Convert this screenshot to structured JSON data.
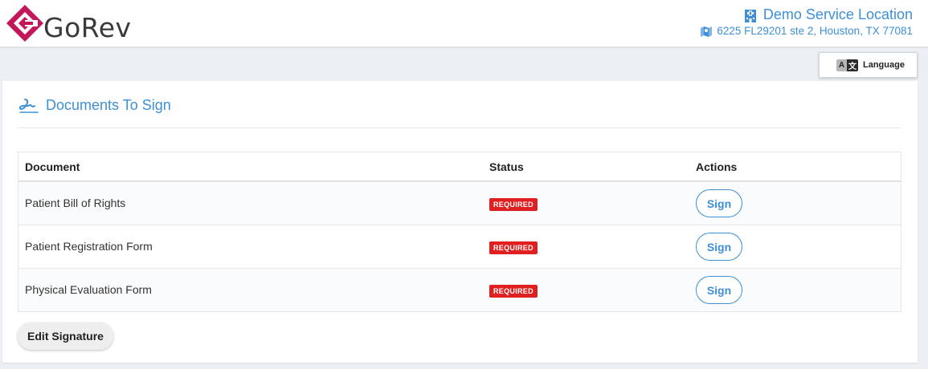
{
  "brand": {
    "name": "GoRev",
    "accent_color": "#c2185b"
  },
  "location": {
    "name": "Demo Service Location",
    "address": "6225 FL29201 ste 2, Houston, TX 77081",
    "name_icon": "building-icon",
    "address_icon": "map-icon",
    "color": "#3d8fd6"
  },
  "language_button": {
    "label": "Language",
    "icon": "translate-icon",
    "icon_glyph_a": "A",
    "icon_glyph_b": "文"
  },
  "documents": {
    "title": "Documents To Sign",
    "title_icon": "signature-icon",
    "columns": {
      "document": "Document",
      "status": "Status",
      "actions": "Actions"
    },
    "rows": [
      {
        "document": "Patient Bill of Rights",
        "status": "REQUIRED",
        "action": "Sign"
      },
      {
        "document": "Patient Registration Form",
        "status": "REQUIRED",
        "action": "Sign"
      },
      {
        "document": "Physical Evaluation Form",
        "status": "REQUIRED",
        "action": "Sign"
      }
    ],
    "status_color": "#e02020"
  },
  "edit_signature_button": {
    "label": "Edit Signature"
  }
}
